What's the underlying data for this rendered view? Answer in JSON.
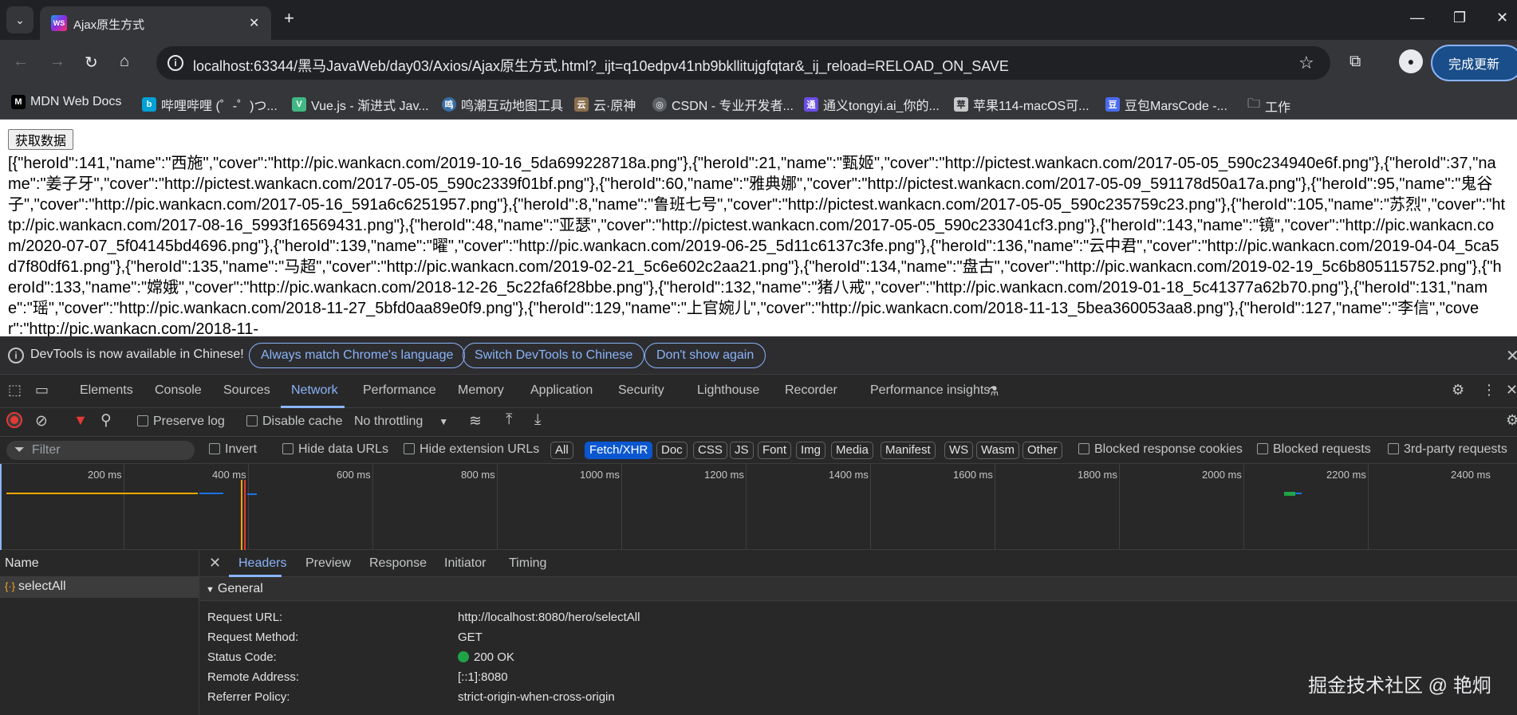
{
  "browser": {
    "tab_title": "Ajax原生方式",
    "url": "localhost:63344/黑马JavaWeb/day03/Axios/Ajax原生方式.html?_ijt=q10edpv41nb9bkllitujgfqtar&_ij_reload=RELOAD_ON_SAVE",
    "update_label": "完成更新",
    "bookmarks": [
      {
        "label": "MDN Web Docs",
        "icon": "M"
      },
      {
        "label": "哔哩哔哩 (゜-゜)つ...",
        "icon": "b"
      },
      {
        "label": "Vue.js - 渐进式 Jav...",
        "icon": "V"
      },
      {
        "label": "鸣潮互动地图工具",
        "icon": "鸣"
      },
      {
        "label": "云·原神",
        "icon": "云"
      },
      {
        "label": "CSDN - 专业开发者...",
        "icon": "C"
      },
      {
        "label": "通义tongyi.ai_你的...",
        "icon": "通"
      },
      {
        "label": "苹果114-macOS可...",
        "icon": "苹"
      },
      {
        "label": "豆包MarsCode -...",
        "icon": "豆"
      },
      {
        "label": "工作",
        "icon": "folder"
      }
    ]
  },
  "page": {
    "button_label": "获取数据",
    "json_text": "[{\"heroId\":141,\"name\":\"西施\",\"cover\":\"http://pic.wankacn.com/2019-10-16_5da699228718a.png\"},{\"heroId\":21,\"name\":\"甄姬\",\"cover\":\"http://pictest.wankacn.com/2017-05-05_590c234940e6f.png\"},{\"heroId\":37,\"name\":\"姜子牙\",\"cover\":\"http://pictest.wankacn.com/2017-05-05_590c2339f01bf.png\"},{\"heroId\":60,\"name\":\"雅典娜\",\"cover\":\"http://pictest.wankacn.com/2017-05-09_591178d50a17a.png\"},{\"heroId\":95,\"name\":\"鬼谷子\",\"cover\":\"http://pic.wankacn.com/2017-05-16_591a6c6251957.png\"},{\"heroId\":8,\"name\":\"鲁班七号\",\"cover\":\"http://pictest.wankacn.com/2017-05-05_590c235759c23.png\"},{\"heroId\":105,\"name\":\"苏烈\",\"cover\":\"http://pic.wankacn.com/2017-08-16_5993f16569431.png\"},{\"heroId\":48,\"name\":\"亚瑟\",\"cover\":\"http://pictest.wankacn.com/2017-05-05_590c233041cf3.png\"},{\"heroId\":143,\"name\":\"镜\",\"cover\":\"http://pic.wankacn.com/2020-07-07_5f04145bd4696.png\"},{\"heroId\":139,\"name\":\"曜\",\"cover\":\"http://pic.wankacn.com/2019-06-25_5d11c6137c3fe.png\"},{\"heroId\":136,\"name\":\"云中君\",\"cover\":\"http://pic.wankacn.com/2019-04-04_5ca5d7f80df61.png\"},{\"heroId\":135,\"name\":\"马超\",\"cover\":\"http://pic.wankacn.com/2019-02-21_5c6e602c2aa21.png\"},{\"heroId\":134,\"name\":\"盘古\",\"cover\":\"http://pic.wankacn.com/2019-02-19_5c6b805115752.png\"},{\"heroId\":133,\"name\":\"嫦娥\",\"cover\":\"http://pic.wankacn.com/2018-12-26_5c22fa6f28bbe.png\"},{\"heroId\":132,\"name\":\"猪八戒\",\"cover\":\"http://pic.wankacn.com/2019-01-18_5c41377a62b70.png\"},{\"heroId\":131,\"name\":\"瑶\",\"cover\":\"http://pic.wankacn.com/2018-11-27_5bfd0aa89e0f9.png\"},{\"heroId\":129,\"name\":\"上官婉儿\",\"cover\":\"http://pic.wankacn.com/2018-11-13_5bea360053aa8.png\"},{\"heroId\":127,\"name\":\"李信\",\"cover\":\"http://pic.wankacn.com/2018-11-"
  },
  "devtools": {
    "lang_notice": "DevTools is now available in Chinese!",
    "lang_btn1": "Always match Chrome's language",
    "lang_btn2": "Switch DevTools to Chinese",
    "lang_btn3": "Don't show again",
    "tabs": [
      "Elements",
      "Console",
      "Sources",
      "Network",
      "Performance",
      "Memory",
      "Application",
      "Security",
      "Lighthouse",
      "Recorder",
      "Performance insights"
    ],
    "preserve_log": "Preserve log",
    "disable_cache": "Disable cache",
    "throttling": "No throttling",
    "filter_placeholder": "Filter",
    "invert": "Invert",
    "hide_data_urls": "Hide data URLs",
    "hide_ext_urls": "Hide extension URLs",
    "type_filters": [
      "All",
      "Fetch/XHR",
      "Doc",
      "CSS",
      "JS",
      "Font",
      "Img",
      "Media",
      "Manifest",
      "WS",
      "Wasm",
      "Other"
    ],
    "blocked_cookies": "Blocked response cookies",
    "blocked_requests": "Blocked requests",
    "third_party": "3rd-party requests",
    "timeline_ticks": [
      "200 ms",
      "400 ms",
      "600 ms",
      "800 ms",
      "1000 ms",
      "1200 ms",
      "1400 ms",
      "1600 ms",
      "1800 ms",
      "2000 ms",
      "2200 ms",
      "2400 ms"
    ],
    "name_header": "Name",
    "request_name": "selectAll",
    "detail_tabs": [
      "Headers",
      "Preview",
      "Response",
      "Initiator",
      "Timing"
    ],
    "general_label": "General",
    "general": {
      "request_url_key": "Request URL:",
      "request_url": "http://localhost:8080/hero/selectAll",
      "method_key": "Request Method:",
      "method": "GET",
      "status_key": "Status Code:",
      "status": "200 OK",
      "remote_key": "Remote Address:",
      "remote": "[::1]:8080",
      "referrer_key": "Referrer Policy:",
      "referrer": "strict-origin-when-cross-origin"
    }
  },
  "watermark": "掘金技术社区 @ 艳炯"
}
